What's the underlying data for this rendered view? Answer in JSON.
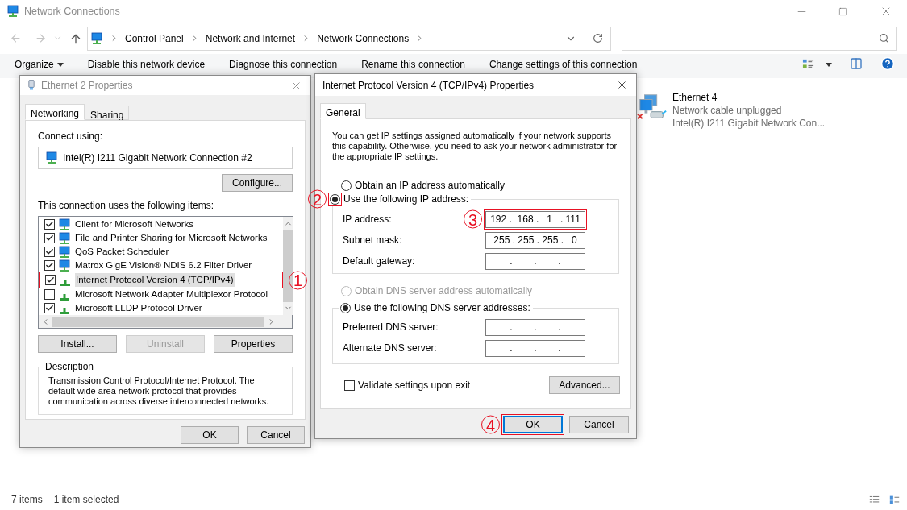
{
  "window": {
    "title": "Network Connections"
  },
  "address_bar": {
    "breadcrumbs": [
      "Control Panel",
      "Network and Internet",
      "Network Connections"
    ]
  },
  "toolbar": [
    {
      "label": "Organize",
      "kind": "menu"
    },
    {
      "label": "Disable this network device",
      "kind": "action"
    },
    {
      "label": "Diagnose this connection",
      "kind": "action"
    },
    {
      "label": "Rename this connection",
      "kind": "action"
    },
    {
      "label": "Change settings of this connection",
      "kind": "action"
    }
  ],
  "connections": [
    {
      "name": "Ethernet 4",
      "status": "Network cable unplugged",
      "adapter": "Intel(R) I211 Gigabit Network Con..."
    }
  ],
  "status_bar": {
    "count": "7 items",
    "selection": "1 item selected"
  },
  "ethernet_dialog": {
    "title": "Ethernet 2 Properties",
    "tabs": [
      {
        "label": "Networking",
        "selected": true
      },
      {
        "label": "Sharing",
        "selected": false
      }
    ],
    "connect_using_label": "Connect using:",
    "adapter": "Intel(R) I211 Gigabit Network Connection #2",
    "configure_button": "Configure...",
    "items_label": "This connection uses the following items:",
    "items": [
      {
        "label": "Client for Microsoft Networks",
        "kind": "client",
        "checked": true,
        "selected": false
      },
      {
        "label": "File and Printer Sharing for Microsoft Networks",
        "kind": "service",
        "checked": true,
        "selected": false
      },
      {
        "label": "QoS Packet Scheduler",
        "kind": "service",
        "checked": true,
        "selected": false
      },
      {
        "label": "Matrox GigE Vision® NDIS 6.2 Filter Driver",
        "kind": "service",
        "checked": true,
        "selected": false
      },
      {
        "label": "Internet Protocol Version 4 (TCP/IPv4)",
        "kind": "protocol",
        "checked": true,
        "selected": true,
        "annotation": "1"
      },
      {
        "label": "Microsoft Network Adapter Multiplexor Protocol",
        "kind": "protocol",
        "checked": false,
        "selected": false
      },
      {
        "label": "Microsoft LLDP Protocol Driver",
        "kind": "protocol",
        "checked": true,
        "selected": false
      }
    ],
    "buttons": [
      {
        "label": "Install...",
        "disabled": false
      },
      {
        "label": "Uninstall",
        "disabled": true
      },
      {
        "label": "Properties",
        "disabled": false
      }
    ],
    "description": {
      "title": "Description",
      "text": "Transmission Control Protocol/Internet Protocol. The default wide area network protocol that provides communication across diverse interconnected networks."
    },
    "footer_buttons": [
      {
        "label": "OK"
      },
      {
        "label": "Cancel"
      }
    ]
  },
  "ipv4_dialog": {
    "title": "Internet Protocol Version 4 (TCP/IPv4) Properties",
    "tabs": [
      {
        "label": "General",
        "selected": true
      }
    ],
    "intro": "You can get IP settings assigned automatically if your network supports this capability. Otherwise, you need to ask your network administrator for the appropriate IP settings.",
    "ip_options": [
      {
        "label": "Obtain an IP address automatically",
        "selected": false,
        "disabled": false
      },
      {
        "label": "Use the following IP address:",
        "selected": true,
        "disabled": false,
        "annotation": "2"
      }
    ],
    "ip_fields": [
      {
        "label": "IP address:",
        "value": "192 .  168 .   1   . 111",
        "annotation": "3"
      },
      {
        "label": "Subnet mask:",
        "value": "255 . 255 . 255 .   0"
      },
      {
        "label": "Default gateway:",
        "value": "    .        .        .    "
      }
    ],
    "dns_options": [
      {
        "label": "Obtain DNS server address automatically",
        "selected": false,
        "disabled": true
      },
      {
        "label": "Use the following DNS server addresses:",
        "selected": true,
        "disabled": false
      }
    ],
    "dns_fields": [
      {
        "label": "Preferred DNS server:",
        "value": "    .        .        .    "
      },
      {
        "label": "Alternate DNS server:",
        "value": "    .        .        .    "
      }
    ],
    "validate": {
      "label": "Validate settings upon exit",
      "checked": false
    },
    "advanced_button": "Advanced...",
    "footer_buttons": [
      {
        "label": "OK",
        "default": true,
        "annotation": "4"
      },
      {
        "label": "Cancel",
        "default": false
      }
    ]
  }
}
